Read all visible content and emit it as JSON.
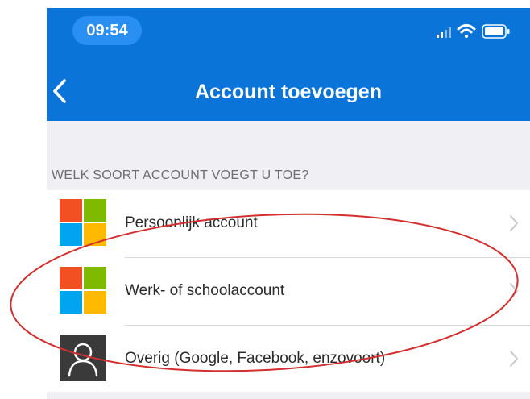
{
  "status_bar": {
    "time": "09:54"
  },
  "header": {
    "title": "Account toevoegen",
    "back_icon": "chevron-left-icon"
  },
  "section": {
    "title": "WELK SOORT ACCOUNT VOEGT U TOE?"
  },
  "accounts": [
    {
      "label": "Persoonlijk account",
      "icon": "microsoft-logo-icon"
    },
    {
      "label": "Werk- of schoolaccount",
      "icon": "microsoft-logo-icon"
    },
    {
      "label": "Overig (Google, Facebook, enzovoort)",
      "icon": "user-icon"
    }
  ],
  "colors": {
    "header": "#0a74d9",
    "time_pill": "#2a8ff2",
    "background": "#efeff4",
    "annotation": "#d32f2f",
    "ms_red": "#f25022",
    "ms_green": "#7fba00",
    "ms_blue": "#00a4ef",
    "ms_yellow": "#ffb900"
  }
}
